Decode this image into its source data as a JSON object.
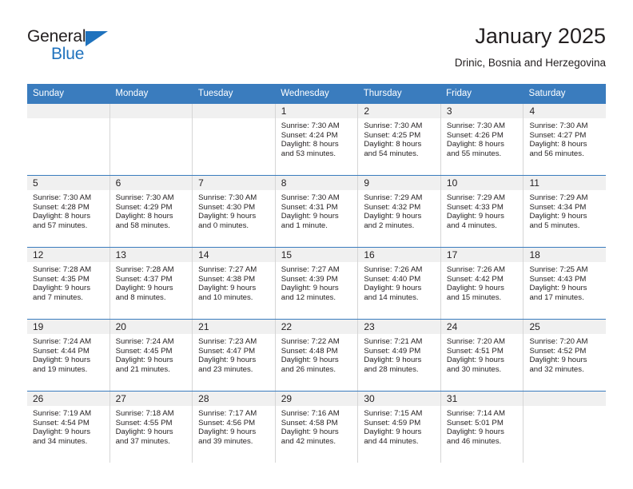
{
  "brand": {
    "name_part1": "General",
    "name_part2": "Blue"
  },
  "header": {
    "month_title": "January 2025",
    "location": "Drinic, Bosnia and Herzegovina"
  },
  "colors": {
    "header_blue": "#3a7cbe",
    "brand_blue": "#1f72bd",
    "day_band_gray": "#f0f0f0",
    "text": "#231f20",
    "cell_border": "#d6d6d6"
  },
  "weekdays": [
    "Sunday",
    "Monday",
    "Tuesday",
    "Wednesday",
    "Thursday",
    "Friday",
    "Saturday"
  ],
  "weeks": [
    [
      {
        "day": "",
        "sunrise": "",
        "sunset": "",
        "daylight_line1": "",
        "daylight_line2": ""
      },
      {
        "day": "",
        "sunrise": "",
        "sunset": "",
        "daylight_line1": "",
        "daylight_line2": ""
      },
      {
        "day": "",
        "sunrise": "",
        "sunset": "",
        "daylight_line1": "",
        "daylight_line2": ""
      },
      {
        "day": "1",
        "sunrise": "Sunrise: 7:30 AM",
        "sunset": "Sunset: 4:24 PM",
        "daylight_line1": "Daylight: 8 hours",
        "daylight_line2": "and 53 minutes."
      },
      {
        "day": "2",
        "sunrise": "Sunrise: 7:30 AM",
        "sunset": "Sunset: 4:25 PM",
        "daylight_line1": "Daylight: 8 hours",
        "daylight_line2": "and 54 minutes."
      },
      {
        "day": "3",
        "sunrise": "Sunrise: 7:30 AM",
        "sunset": "Sunset: 4:26 PM",
        "daylight_line1": "Daylight: 8 hours",
        "daylight_line2": "and 55 minutes."
      },
      {
        "day": "4",
        "sunrise": "Sunrise: 7:30 AM",
        "sunset": "Sunset: 4:27 PM",
        "daylight_line1": "Daylight: 8 hours",
        "daylight_line2": "and 56 minutes."
      }
    ],
    [
      {
        "day": "5",
        "sunrise": "Sunrise: 7:30 AM",
        "sunset": "Sunset: 4:28 PM",
        "daylight_line1": "Daylight: 8 hours",
        "daylight_line2": "and 57 minutes."
      },
      {
        "day": "6",
        "sunrise": "Sunrise: 7:30 AM",
        "sunset": "Sunset: 4:29 PM",
        "daylight_line1": "Daylight: 8 hours",
        "daylight_line2": "and 58 minutes."
      },
      {
        "day": "7",
        "sunrise": "Sunrise: 7:30 AM",
        "sunset": "Sunset: 4:30 PM",
        "daylight_line1": "Daylight: 9 hours",
        "daylight_line2": "and 0 minutes."
      },
      {
        "day": "8",
        "sunrise": "Sunrise: 7:30 AM",
        "sunset": "Sunset: 4:31 PM",
        "daylight_line1": "Daylight: 9 hours",
        "daylight_line2": "and 1 minute."
      },
      {
        "day": "9",
        "sunrise": "Sunrise: 7:29 AM",
        "sunset": "Sunset: 4:32 PM",
        "daylight_line1": "Daylight: 9 hours",
        "daylight_line2": "and 2 minutes."
      },
      {
        "day": "10",
        "sunrise": "Sunrise: 7:29 AM",
        "sunset": "Sunset: 4:33 PM",
        "daylight_line1": "Daylight: 9 hours",
        "daylight_line2": "and 4 minutes."
      },
      {
        "day": "11",
        "sunrise": "Sunrise: 7:29 AM",
        "sunset": "Sunset: 4:34 PM",
        "daylight_line1": "Daylight: 9 hours",
        "daylight_line2": "and 5 minutes."
      }
    ],
    [
      {
        "day": "12",
        "sunrise": "Sunrise: 7:28 AM",
        "sunset": "Sunset: 4:35 PM",
        "daylight_line1": "Daylight: 9 hours",
        "daylight_line2": "and 7 minutes."
      },
      {
        "day": "13",
        "sunrise": "Sunrise: 7:28 AM",
        "sunset": "Sunset: 4:37 PM",
        "daylight_line1": "Daylight: 9 hours",
        "daylight_line2": "and 8 minutes."
      },
      {
        "day": "14",
        "sunrise": "Sunrise: 7:27 AM",
        "sunset": "Sunset: 4:38 PM",
        "daylight_line1": "Daylight: 9 hours",
        "daylight_line2": "and 10 minutes."
      },
      {
        "day": "15",
        "sunrise": "Sunrise: 7:27 AM",
        "sunset": "Sunset: 4:39 PM",
        "daylight_line1": "Daylight: 9 hours",
        "daylight_line2": "and 12 minutes."
      },
      {
        "day": "16",
        "sunrise": "Sunrise: 7:26 AM",
        "sunset": "Sunset: 4:40 PM",
        "daylight_line1": "Daylight: 9 hours",
        "daylight_line2": "and 14 minutes."
      },
      {
        "day": "17",
        "sunrise": "Sunrise: 7:26 AM",
        "sunset": "Sunset: 4:42 PM",
        "daylight_line1": "Daylight: 9 hours",
        "daylight_line2": "and 15 minutes."
      },
      {
        "day": "18",
        "sunrise": "Sunrise: 7:25 AM",
        "sunset": "Sunset: 4:43 PM",
        "daylight_line1": "Daylight: 9 hours",
        "daylight_line2": "and 17 minutes."
      }
    ],
    [
      {
        "day": "19",
        "sunrise": "Sunrise: 7:24 AM",
        "sunset": "Sunset: 4:44 PM",
        "daylight_line1": "Daylight: 9 hours",
        "daylight_line2": "and 19 minutes."
      },
      {
        "day": "20",
        "sunrise": "Sunrise: 7:24 AM",
        "sunset": "Sunset: 4:45 PM",
        "daylight_line1": "Daylight: 9 hours",
        "daylight_line2": "and 21 minutes."
      },
      {
        "day": "21",
        "sunrise": "Sunrise: 7:23 AM",
        "sunset": "Sunset: 4:47 PM",
        "daylight_line1": "Daylight: 9 hours",
        "daylight_line2": "and 23 minutes."
      },
      {
        "day": "22",
        "sunrise": "Sunrise: 7:22 AM",
        "sunset": "Sunset: 4:48 PM",
        "daylight_line1": "Daylight: 9 hours",
        "daylight_line2": "and 26 minutes."
      },
      {
        "day": "23",
        "sunrise": "Sunrise: 7:21 AM",
        "sunset": "Sunset: 4:49 PM",
        "daylight_line1": "Daylight: 9 hours",
        "daylight_line2": "and 28 minutes."
      },
      {
        "day": "24",
        "sunrise": "Sunrise: 7:20 AM",
        "sunset": "Sunset: 4:51 PM",
        "daylight_line1": "Daylight: 9 hours",
        "daylight_line2": "and 30 minutes."
      },
      {
        "day": "25",
        "sunrise": "Sunrise: 7:20 AM",
        "sunset": "Sunset: 4:52 PM",
        "daylight_line1": "Daylight: 9 hours",
        "daylight_line2": "and 32 minutes."
      }
    ],
    [
      {
        "day": "26",
        "sunrise": "Sunrise: 7:19 AM",
        "sunset": "Sunset: 4:54 PM",
        "daylight_line1": "Daylight: 9 hours",
        "daylight_line2": "and 34 minutes."
      },
      {
        "day": "27",
        "sunrise": "Sunrise: 7:18 AM",
        "sunset": "Sunset: 4:55 PM",
        "daylight_line1": "Daylight: 9 hours",
        "daylight_line2": "and 37 minutes."
      },
      {
        "day": "28",
        "sunrise": "Sunrise: 7:17 AM",
        "sunset": "Sunset: 4:56 PM",
        "daylight_line1": "Daylight: 9 hours",
        "daylight_line2": "and 39 minutes."
      },
      {
        "day": "29",
        "sunrise": "Sunrise: 7:16 AM",
        "sunset": "Sunset: 4:58 PM",
        "daylight_line1": "Daylight: 9 hours",
        "daylight_line2": "and 42 minutes."
      },
      {
        "day": "30",
        "sunrise": "Sunrise: 7:15 AM",
        "sunset": "Sunset: 4:59 PM",
        "daylight_line1": "Daylight: 9 hours",
        "daylight_line2": "and 44 minutes."
      },
      {
        "day": "31",
        "sunrise": "Sunrise: 7:14 AM",
        "sunset": "Sunset: 5:01 PM",
        "daylight_line1": "Daylight: 9 hours",
        "daylight_line2": "and 46 minutes."
      },
      {
        "day": "",
        "sunrise": "",
        "sunset": "",
        "daylight_line1": "",
        "daylight_line2": ""
      }
    ]
  ]
}
